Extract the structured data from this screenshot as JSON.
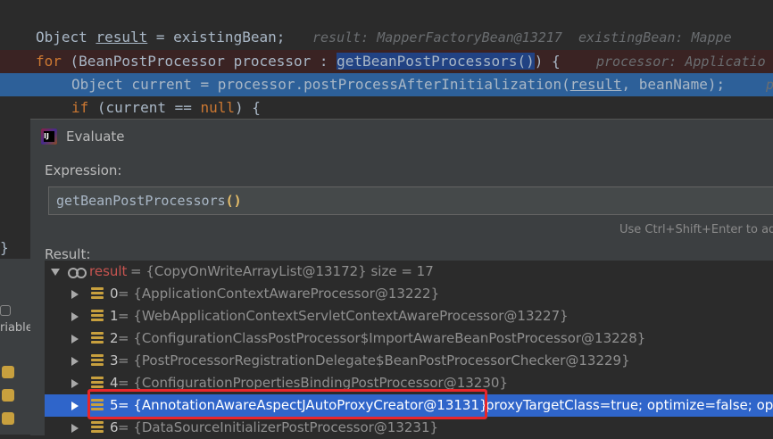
{
  "editor": {
    "line1": {
      "prefix": "Object ",
      "var": "result",
      "suffix": " = existingBean;",
      "hint": "result: MapperFactoryBean@13217  existingBean: Mappe"
    },
    "line2": {
      "kw": "for",
      "part1": " (BeanPostProcessor processor : ",
      "selected": "getBeanPostProcessors()",
      "part2": ") {",
      "hint": "processor: Applicatio"
    },
    "line3": {
      "prefix": "Object current = processor.postProcessAfterInitialization(",
      "arg": "result",
      "suffix": ", beanName);",
      "hint": "p"
    },
    "line4": {
      "kw": "if",
      "mid": " (current == ",
      "kw2": "null",
      "end": ") {"
    },
    "closing_brace": "}"
  },
  "left_panel": {
    "variables_tab": "riables"
  },
  "dialog": {
    "title": "Evaluate",
    "app_icon_text": "IJ",
    "expression_label": "Expression:",
    "expression_value": "getBeanPostProcessors",
    "expression_parens": "()",
    "hint": "Use Ctrl+Shift+Enter to add",
    "result_label": "Result:",
    "tree": {
      "root": {
        "name": "result",
        "value": " = {CopyOnWriteArrayList@13172}  size = 17"
      },
      "items": [
        {
          "index": "0",
          "value": " = {ApplicationContextAwareProcessor@13222}"
        },
        {
          "index": "1",
          "value": " = {WebApplicationContextServletContextAwareProcessor@13227}"
        },
        {
          "index": "2",
          "value": " = {ConfigurationClassPostProcessor$ImportAwareBeanPostProcessor@13228}"
        },
        {
          "index": "3",
          "value": " = {PostProcessorRegistrationDelegate$BeanPostProcessorChecker@13229}"
        },
        {
          "index": "4",
          "value": " = {ConfigurationPropertiesBindingPostProcessor@13230}"
        },
        {
          "index": "5",
          "value": " = {AnnotationAwareAspectJAutoProxyCreator@13131}",
          "extra": " proxyTargetClass=true; optimize=false; opa"
        },
        {
          "index": "6",
          "value": " = {DataSourceInitializerPostProcessor@13231}"
        }
      ]
    }
  },
  "colors": {
    "selection": "#2f65ca",
    "highlight_border": "#e8262b",
    "keyword": "#cc7832",
    "field_icon": "#c8a03e"
  }
}
